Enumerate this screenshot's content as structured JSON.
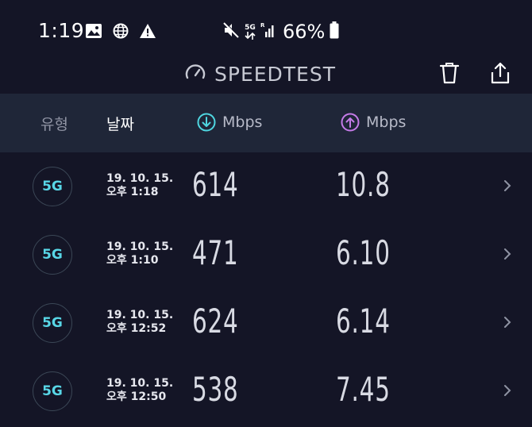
{
  "status_bar": {
    "time": "1:19",
    "battery": "66%",
    "network": "5G"
  },
  "header": {
    "title": "SPEEDTEST"
  },
  "columns": {
    "type": "유형",
    "date": "날짜",
    "download_unit": "Mbps",
    "upload_unit": "Mbps"
  },
  "colors": {
    "background": "#141526",
    "header_band": "#1f2638",
    "download_accent": "#4fd6e0",
    "upload_accent": "#c57be8",
    "badge_text": "#58d6e6"
  },
  "results": [
    {
      "type": "5G",
      "date": "19. 10. 15.",
      "time": "오후 1:18",
      "download": "614",
      "upload": "10.8"
    },
    {
      "type": "5G",
      "date": "19. 10. 15.",
      "time": "오후 1:10",
      "download": "471",
      "upload": "6.10"
    },
    {
      "type": "5G",
      "date": "19. 10. 15.",
      "time": "오후 12:52",
      "download": "624",
      "upload": "6.14"
    },
    {
      "type": "5G",
      "date": "19. 10. 15.",
      "time": "오후 12:50",
      "download": "538",
      "upload": "7.45"
    }
  ]
}
